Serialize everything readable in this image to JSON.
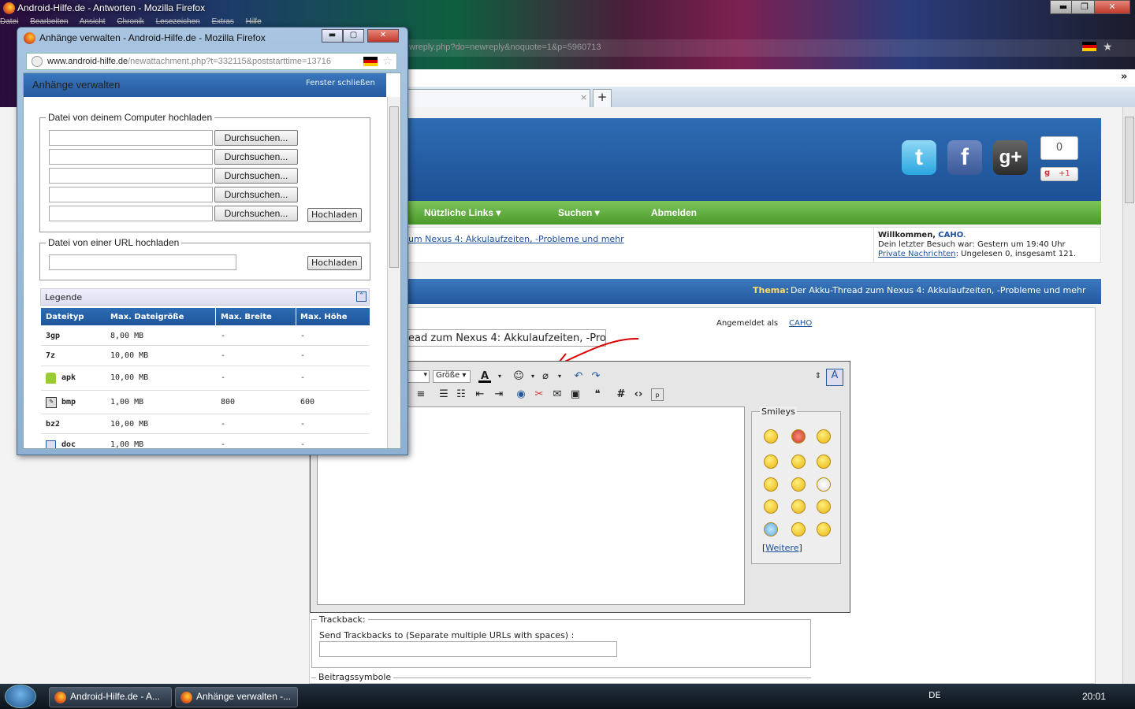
{
  "main_window": {
    "title": "Android-Hilfe.de - Antworten - Mozilla Firefox",
    "menu": [
      "Datei",
      "Bearbeiten",
      "Ansicht",
      "Chronik",
      "Lesezeichen",
      "Extras",
      "Hilfe"
    ],
    "url": "wreply.php?do=newreply&noquote=1&p=5960713",
    "minimize": "▬",
    "maximize": "❐",
    "close": "✕"
  },
  "site": {
    "gplus_count": "0",
    "gplus_label": "+1",
    "nav": [
      "Nützliche Links ▾",
      "Suchen ▾",
      "Abmelden"
    ],
    "breadcrumb_link": "um Nexus 4: Akkulaufzeiten, -Probleme und mehr",
    "welcome_prefix": "Willkommen,",
    "welcome_user": "CAHO",
    "last_visit": "Dein letzter Besuch war: Gestern um 19:40 Uhr",
    "pm_link": "Private Nachrichten",
    "pm_status": ": Ungelesen 0, insgesamt 121.",
    "thread_label": "Thema:",
    "thread_title": "Der Akku-Thread zum Nexus 4: Akkulaufzeiten, -Probleme und mehr",
    "logged_in_as": "Angemeldet als",
    "logged_in_user": "CAHO",
    "title_field_value": "ead zum Nexus 4: Akkulaufzeiten, -Pro",
    "size_select": "Größe",
    "smileys_title": "Smileys",
    "more_smileys": "Weitere",
    "trackback_legend": "Trackback:",
    "trackback_label": "Send Trackbacks to (Separate multiple URLs with spaces) :",
    "symbols_legend": "Beitragssymbole"
  },
  "popup": {
    "title": "Anhänge verwalten - Android-Hilfe.de - Mozilla Firefox",
    "url_domain": "www.android-hilfe.de",
    "url_path": "/newattachment.php?t=332115&poststarttime=13716",
    "header": "Anhänge verwalten",
    "close_link": "Fenster schließen",
    "computer_upload_legend": "Datei von deinem Computer hochladen",
    "browse_label": "Durchsuchen...",
    "upload_label": "Hochladen",
    "url_upload_legend": "Datei von einer URL hochladen",
    "legend_title": "Legende",
    "columns": [
      "Dateityp",
      "Max. Dateigröße",
      "Max. Breite",
      "Max. Höhe"
    ],
    "rows": [
      {
        "type": "3gp",
        "size": "8,00 MB",
        "width": "-",
        "height": "-"
      },
      {
        "type": "7z",
        "size": "10,00 MB",
        "width": "-",
        "height": "-"
      },
      {
        "type": "apk",
        "size": "10,00 MB",
        "width": "-",
        "height": "-"
      },
      {
        "type": "bmp",
        "size": "1,00 MB",
        "width": "800",
        "height": "600"
      },
      {
        "type": "bz2",
        "size": "10,00 MB",
        "width": "-",
        "height": "-"
      },
      {
        "type": "doc",
        "size": "1,00 MB",
        "width": "-",
        "height": "-"
      }
    ]
  },
  "taskbar": {
    "items": [
      "Android-Hilfe.de - A...",
      "Anhänge verwalten -..."
    ],
    "lang": "DE",
    "clock": "20:01"
  },
  "colors": {
    "header_blue": "#2e6cb3",
    "nav_green": "#5fae3a"
  }
}
